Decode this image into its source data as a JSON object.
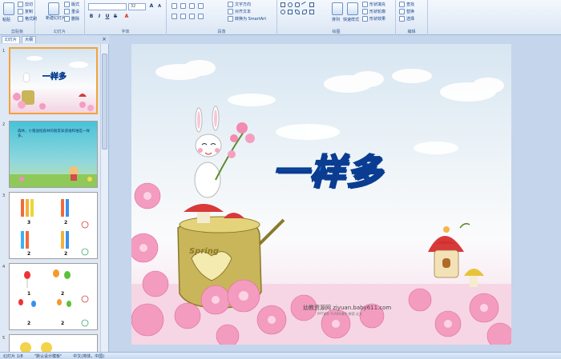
{
  "ribbon": {
    "groups": [
      {
        "label": "剪贴板"
      },
      {
        "label": "幻灯片"
      },
      {
        "label": "字体"
      },
      {
        "label": "段落"
      },
      {
        "label": "绘图"
      },
      {
        "label": "编辑"
      }
    ],
    "clipboard": {
      "paste": "粘贴",
      "cut": "剪切",
      "copy": "复制",
      "format_painter": "格式刷"
    },
    "slides": {
      "new_slide": "新建幻灯片",
      "layout": "版式",
      "reset": "重设",
      "delete": "删除"
    },
    "font": {
      "size": "32"
    },
    "paragraph": {
      "text_direction": "文字方向",
      "align_text": "对齐文本",
      "smartart": "转换为 SmartArt"
    },
    "drawing": {
      "arrange": "排列",
      "quick_styles": "快速样式",
      "shape_fill": "形状填充",
      "shape_outline": "形状轮廓",
      "shape_effects": "形状效果"
    },
    "editing": {
      "find": "查找",
      "replace": "替换",
      "select": "选择"
    }
  },
  "panel": {
    "tabs": [
      "幻灯片",
      "大纲"
    ],
    "thumbs": [
      {
        "num": "1",
        "title": "一样多"
      },
      {
        "num": "2",
        "text": "森林，小猪送给森林的朋友知道谁和谁是一样多。"
      },
      {
        "num": "3",
        "counts": [
          "3",
          "2",
          "2",
          "2"
        ]
      },
      {
        "num": "4",
        "counts": [
          "1",
          "2",
          "2",
          "2"
        ]
      },
      {
        "num": "5"
      }
    ]
  },
  "slide": {
    "title": "一样多",
    "stump_text": "Spring",
    "watermark": "幼教资源网 ziyuan.baby611.com",
    "watermark_sub": "PPT课件  FLASH课件  教案  论文"
  },
  "status": {
    "slide_count": "幻灯片 1/8",
    "theme": "\"默认设计模板\"",
    "language": "中文(简体，中国)"
  },
  "colors": {
    "title_blue": "#1f7fe6",
    "accent_orange": "#f2a33a"
  }
}
